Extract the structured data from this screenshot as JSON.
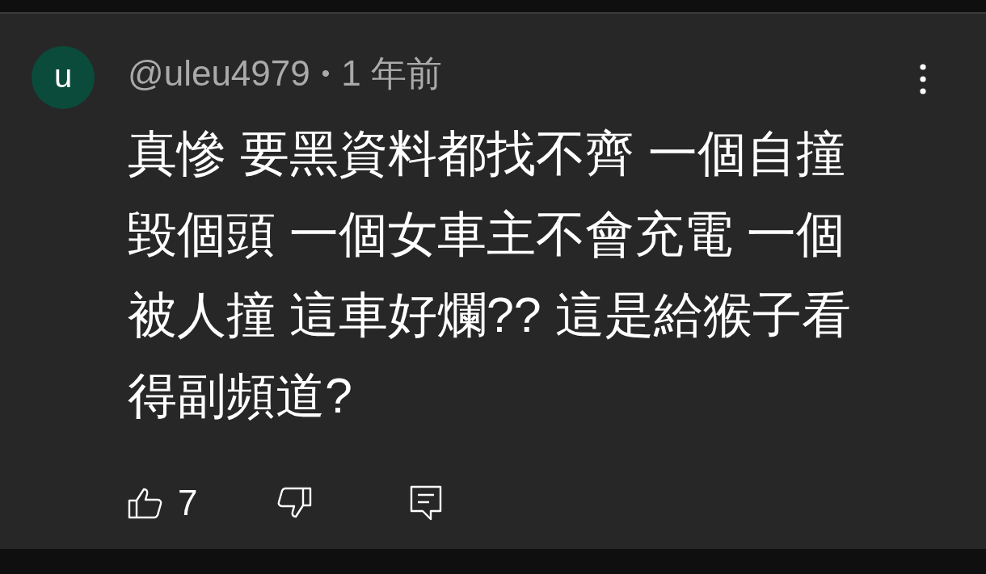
{
  "comment": {
    "avatar_letter": "u",
    "author": "@uleu4979",
    "separator": "•",
    "time": "1 年前",
    "text": "真慘 要黑資料都找不齊 一個自撞毀個頭 一個女車主不會充電 一個被人撞 這車好爛?? 這是給猴子看得副頻道?",
    "like_count": "7"
  }
}
